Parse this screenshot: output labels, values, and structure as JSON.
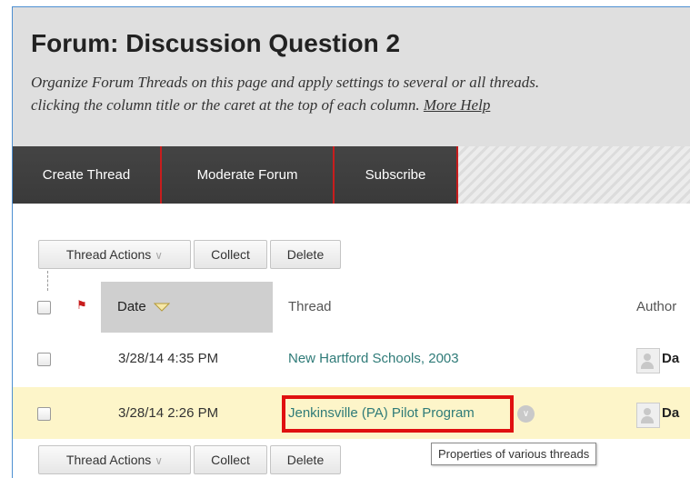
{
  "header": {
    "title": "Forum: Discussion Question 2",
    "description_line1": "Organize Forum Threads on this page and apply settings to several or all threads.",
    "description_line2": "clicking the column title or the caret at the top of each column.",
    "more_help": "More Help"
  },
  "toolbar": {
    "create_thread": "Create Thread",
    "moderate_forum": "Moderate Forum",
    "subscribe": "Subscribe"
  },
  "actions": {
    "thread_actions": "Thread Actions",
    "collect": "Collect",
    "delete": "Delete"
  },
  "table": {
    "columns": {
      "date": "Date",
      "thread": "Thread",
      "author": "Author"
    },
    "sort_icon": "triangle-down-icon",
    "rows": [
      {
        "date": "3/28/14 4:35 PM",
        "thread": "New Hartford Schools, 2003",
        "author": "Da",
        "highlighted": false
      },
      {
        "date": "3/28/14 2:26 PM",
        "thread": "Jenkinsville (PA) Pilot Program",
        "author": "Da",
        "highlighted": true
      }
    ]
  },
  "tooltip": "Properties of various threads",
  "colors": {
    "accent_red": "#c81d1d",
    "link": "#2f7b78",
    "row_highlight": "#fdf5c9",
    "toolbar_dark": "#3f3f3f"
  }
}
